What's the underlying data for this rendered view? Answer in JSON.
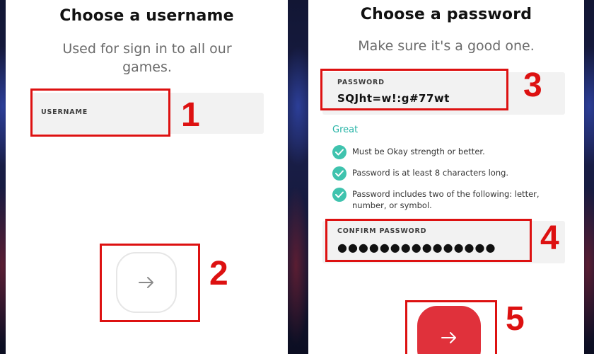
{
  "username_screen": {
    "title": "Choose a username",
    "subtitle": "Used for sign in to all our games.",
    "username_label": "USERNAME",
    "next_icon": "arrow-right-icon"
  },
  "password_screen": {
    "title": "Choose a password",
    "subtitle": "Make sure it's a good one.",
    "password_label": "PASSWORD",
    "password_value": "SQJht=w!:g#77wt",
    "strength_text": "Great",
    "requirements": [
      {
        "icon": "check-circle-icon",
        "text": "Must be Okay strength or better."
      },
      {
        "icon": "check-circle-icon",
        "text": "Password is at least 8 characters long."
      },
      {
        "icon": "check-circle-icon",
        "text": "Password includes two of the following: letter, number, or symbol."
      }
    ],
    "confirm_label": "CONFIRM PASSWORD",
    "confirm_value": "●●●●●●●●●●●●●●●",
    "next_icon": "arrow-right-icon"
  },
  "callouts": [
    "1",
    "2",
    "3",
    "4",
    "5"
  ],
  "colors": {
    "accent_red": "#e0313b",
    "callout_red": "#dd1111",
    "success_teal": "#3fc3ae",
    "strength_text": "#24b3a5",
    "field_bg": "#f2f2f2"
  }
}
